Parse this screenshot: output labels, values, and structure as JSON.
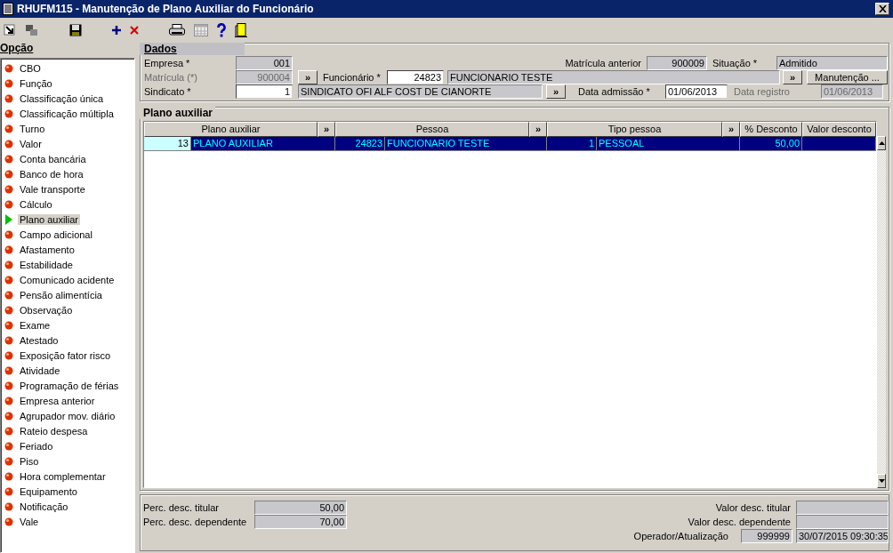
{
  "window": {
    "title": "RHUFM115 - Manutenção de Plano Auxiliar do Funcionário"
  },
  "sidebar": {
    "title": "Opção",
    "items": [
      {
        "label": "CBO",
        "selected": false
      },
      {
        "label": "Função",
        "selected": false
      },
      {
        "label": "Classificação única",
        "selected": false
      },
      {
        "label": "Classificação múltipla",
        "selected": false
      },
      {
        "label": "Turno",
        "selected": false
      },
      {
        "label": "Valor",
        "selected": false
      },
      {
        "label": "Conta bancária",
        "selected": false
      },
      {
        "label": "Banco de hora",
        "selected": false
      },
      {
        "label": "Vale transporte",
        "selected": false
      },
      {
        "label": "Cálculo",
        "selected": false
      },
      {
        "label": "Plano auxiliar",
        "selected": true
      },
      {
        "label": "Campo adicional",
        "selected": false
      },
      {
        "label": "Afastamento",
        "selected": false
      },
      {
        "label": "Estabilidade",
        "selected": false
      },
      {
        "label": "Comunicado acidente",
        "selected": false
      },
      {
        "label": "Pensão alimentícia",
        "selected": false
      },
      {
        "label": "Observação",
        "selected": false
      },
      {
        "label": "Exame",
        "selected": false
      },
      {
        "label": "Atestado",
        "selected": false
      },
      {
        "label": "Exposição fator risco",
        "selected": false
      },
      {
        "label": "Atividade",
        "selected": false
      },
      {
        "label": "Programação de férias",
        "selected": false
      },
      {
        "label": "Empresa anterior",
        "selected": false
      },
      {
        "label": "Agrupador mov. diário",
        "selected": false
      },
      {
        "label": "Rateio despesa",
        "selected": false
      },
      {
        "label": "Feriado",
        "selected": false
      },
      {
        "label": "Piso",
        "selected": false
      },
      {
        "label": "Hora complementar",
        "selected": false
      },
      {
        "label": "Equipamento",
        "selected": false
      },
      {
        "label": "Notificação",
        "selected": false
      },
      {
        "label": "Vale",
        "selected": false
      }
    ]
  },
  "dados": {
    "title": "Dados",
    "empresa": {
      "label": "Empresa *",
      "value": "001",
      "kind": "display",
      "disabled": false
    },
    "matricula_anterior": {
      "label": "Matrícula anterior",
      "value": "900009",
      "kind": "display",
      "disabled": false
    },
    "situacao": {
      "label": "Situação *",
      "value": "Admitido",
      "kind": "display",
      "disabled": false
    },
    "matricula": {
      "label": "Matrícula (*)",
      "value": "900004",
      "kind": "display",
      "disabled": true,
      "lookup": "»"
    },
    "funcionario": {
      "label": "Funcionário *",
      "value": "24823",
      "name": "FUNCIONARIO TESTE",
      "kind": "input",
      "disabled": false,
      "lookup": "»"
    },
    "manutencao_button": "Manutenção ...",
    "sindicato": {
      "label": "Sindicato *",
      "value": "1",
      "name": "SINDICATO OFI ALF COST DE CIANORTE",
      "kind": "input",
      "disabled": false,
      "lookup": "»"
    },
    "data_admissao": {
      "label": "Data admissão *",
      "value": "01/06/2013",
      "kind": "input",
      "disabled": false
    },
    "data_registro": {
      "label": "Data registro",
      "value": "01/06/2013",
      "kind": "display",
      "disabled": true
    }
  },
  "plano_auxiliar": {
    "title": "Plano auxiliar",
    "columns": [
      {
        "label": "Plano auxiliar",
        "lookup": "»"
      },
      {
        "label": "Pessoa",
        "lookup": "»"
      },
      {
        "label": "Tipo pessoa",
        "lookup": "»"
      },
      {
        "label": "% Desconto"
      },
      {
        "label": "Valor desconto"
      }
    ],
    "rows": [
      {
        "selected": true,
        "cells": [
          {
            "code": "13",
            "name": "PLANO AUXILIAR",
            "focused": true
          },
          {
            "code": "24823",
            "name": "FUNCIONARIO TESTE",
            "focused": false
          },
          {
            "code": "1",
            "name": "PESSOAL",
            "focused": false
          },
          {
            "text": "50,00",
            "focused": false
          },
          {
            "text": "",
            "focused": false
          }
        ]
      }
    ]
  },
  "totais": {
    "perc_titular": {
      "label": "Perc. desc. titular",
      "value": "50,00"
    },
    "perc_dependente": {
      "label": "Perc. desc. dependente",
      "value": "70,00"
    },
    "valor_titular": {
      "label": "Valor desc. titular"
    },
    "valor_dependente": {
      "label": "Valor desc. dependente"
    },
    "operador": {
      "label": "Operador/Atualização",
      "value": "999999",
      "timestamp": "30/07/2015 09:30:35"
    }
  }
}
